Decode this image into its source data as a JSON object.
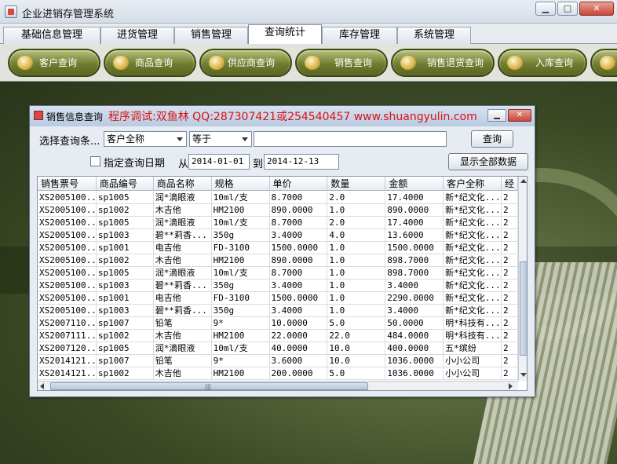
{
  "window": {
    "title": "企业进销存管理系统",
    "min": "▁",
    "max": "□",
    "close": "✕"
  },
  "tabs": [
    "基础信息管理",
    "进货管理",
    "销售管理",
    "查询统计",
    "库存管理",
    "系统管理"
  ],
  "active_tab": "查询统计",
  "toolbar": [
    "客户查询",
    "商品查询",
    "供应商查询",
    "销售查询",
    "销售退货查询",
    "入库查询"
  ],
  "dialog": {
    "title": "销售信息查询",
    "note": "程序调试:双鱼林 QQ:287307421或254540457 www.shuangyulin.com",
    "min": "▁",
    "close": "✕",
    "condition_label": "选择查询条...",
    "field_select": "客户全称",
    "operator_select": "等于",
    "search_value": "",
    "query_button": "查询",
    "date_checkbox_label": "指定查询日期",
    "from_label": "从",
    "from_date": "2014-01-01",
    "to_label": "到",
    "to_date": "2014-12-13",
    "show_all_button": "显示全部数据"
  },
  "table": {
    "headers": [
      "销售票号",
      "商品编号",
      "商品名称",
      "规格",
      "单价",
      "数量",
      "金额",
      "客户全称",
      "经"
    ],
    "rows": [
      [
        "XS2005100...",
        "sp1005",
        "润*滴眼液",
        "10ml/支",
        "8.7000",
        "2.0",
        "17.4000",
        "新*纪文化...",
        "2"
      ],
      [
        "XS2005100...",
        "sp1002",
        "木吉他",
        "HM2100",
        "890.0000",
        "1.0",
        "890.0000",
        "新*纪文化...",
        "2"
      ],
      [
        "XS2005100...",
        "sp1005",
        "润*滴眼液",
        "10ml/支",
        "8.7000",
        "2.0",
        "17.4000",
        "新*纪文化...",
        "2"
      ],
      [
        "XS2005100...",
        "sp1003",
        "碧**莉香...",
        "350g",
        "3.4000",
        "4.0",
        "13.6000",
        "新*纪文化...",
        "2"
      ],
      [
        "XS2005100...",
        "sp1001",
        "电吉他",
        "FD-3100",
        "1500.0000",
        "1.0",
        "1500.0000",
        "新*纪文化...",
        "2"
      ],
      [
        "XS2005100...",
        "sp1002",
        "木吉他",
        "HM2100",
        "890.0000",
        "1.0",
        "898.7000",
        "新*纪文化...",
        "2"
      ],
      [
        "XS2005100...",
        "sp1005",
        "润*滴眼液",
        "10ml/支",
        "8.7000",
        "1.0",
        "898.7000",
        "新*纪文化...",
        "2"
      ],
      [
        "XS2005100...",
        "sp1003",
        "碧**莉香...",
        "350g",
        "3.4000",
        "1.0",
        "3.4000",
        "新*纪文化...",
        "2"
      ],
      [
        "XS2005100...",
        "sp1001",
        "电吉他",
        "FD-3100",
        "1500.0000",
        "1.0",
        "2290.0000",
        "新*纪文化...",
        "2"
      ],
      [
        "XS2005100...",
        "sp1003",
        "碧**莉香...",
        "350g",
        "3.4000",
        "1.0",
        "3.4000",
        "新*纪文化...",
        "2"
      ],
      [
        "XS2007110...",
        "sp1007",
        "铅笔",
        "9*",
        "10.0000",
        "5.0",
        "50.0000",
        "明*科技有...",
        "2"
      ],
      [
        "XS2007111...",
        "sp1002",
        "木吉他",
        "HM2100",
        "22.0000",
        "22.0",
        "484.0000",
        "明*科技有...",
        "2"
      ],
      [
        "XS2007120...",
        "sp1005",
        "润*滴眼液",
        "10ml/支",
        "40.0000",
        "10.0",
        "400.0000",
        "五*缤纷",
        "2"
      ],
      [
        "XS2014121...",
        "sp1007",
        "铅笔",
        "9*",
        "3.6000",
        "10.0",
        "1036.0000",
        "小小公司",
        "2"
      ],
      [
        "XS2014121...",
        "sp1002",
        "木吉他",
        "HM2100",
        "200.0000",
        "5.0",
        "1036.0000",
        "小小公司",
        "2"
      ]
    ]
  }
}
